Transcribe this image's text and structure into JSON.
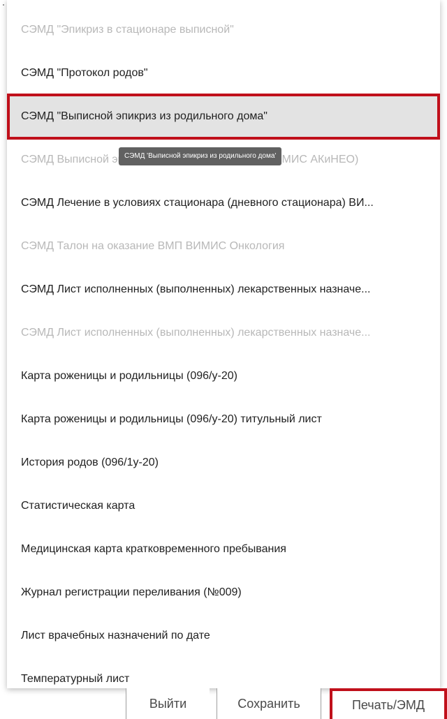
{
  "menu": {
    "items": [
      {
        "label": "СЭМД \"Эпикриз в стационаре выписной\"",
        "state": "disabled"
      },
      {
        "label": "СЭМД \"Протокол родов\"",
        "state": "enabled"
      },
      {
        "label": "СЭМД \"Выписной эпикриз из родильного дома\"",
        "state": "highlighted"
      },
      {
        "label": "СЭМД Выписной эпикриз из родильного дома (ВИМИС АКиНЕО)",
        "state": "disabled"
      },
      {
        "label": "СЭМД Лечение в условиях стационара (дневного стационара) ВИ...",
        "state": "enabled"
      },
      {
        "label": "СЭМД Талон на оказание ВМП ВИМИС Онкология",
        "state": "disabled"
      },
      {
        "label": "СЭМД Лист исполненных (выполненных) лекарственных назначе...",
        "state": "enabled"
      },
      {
        "label": "СЭМД Лист исполненных (выполненных) лекарственных назначе...",
        "state": "disabled"
      },
      {
        "label": "Карта роженицы и родильницы (096/у-20)",
        "state": "enabled"
      },
      {
        "label": "Карта роженицы и родильницы (096/у-20) титульный лист",
        "state": "enabled"
      },
      {
        "label": "История родов (096/1у-20)",
        "state": "enabled"
      },
      {
        "label": "Статистическая карта",
        "state": "enabled"
      },
      {
        "label": "Медицинская карта кратковременного пребывания",
        "state": "enabled"
      },
      {
        "label": "Журнал регистрации переливания (№009)",
        "state": "enabled"
      },
      {
        "label": "Лист врачебных назначений по дате",
        "state": "enabled"
      },
      {
        "label": "Температурный лист",
        "state": "enabled"
      }
    ],
    "tooltip": "СЭМД 'Выписной эпикриз из родильного дома'"
  },
  "footer": {
    "exit_label": "Выйти",
    "save_label": "Сохранить",
    "print_label": "Печать/ЭМД"
  },
  "colors": {
    "highlight_border": "#c0101b",
    "highlight_bg": "#e3e3e3",
    "disabled_text": "#b8b8b8",
    "tooltip_bg": "#616161"
  }
}
